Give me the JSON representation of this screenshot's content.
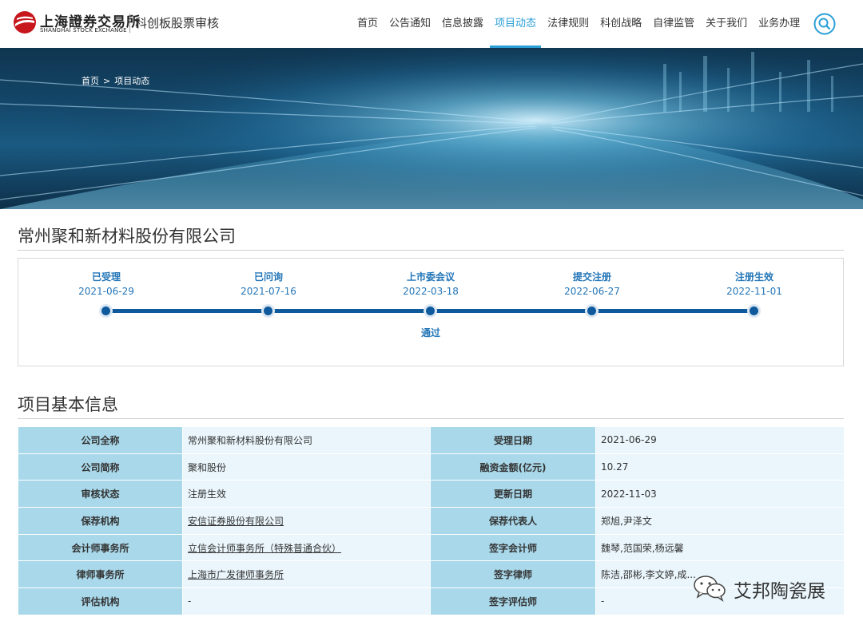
{
  "header": {
    "logo_cn": "上海證券交易所",
    "logo_en": "SHANGHAI STOCK EXCHANGE",
    "site_title": "科创板股票审核",
    "nav": [
      "首页",
      "公告通知",
      "信息披露",
      "项目动态",
      "法律规则",
      "科创战略",
      "自律监管",
      "关于我们",
      "业务办理"
    ],
    "active_nav": "项目动态",
    "search_icon": "search-icon"
  },
  "banner": {
    "breadcrumb": {
      "home": "首页",
      "separator": ">",
      "current": "项目动态"
    }
  },
  "company": {
    "name": "常州聚和新材料股份有限公司"
  },
  "timeline": {
    "steps": [
      {
        "label": "已受理",
        "date": "2021-06-29"
      },
      {
        "label": "已问询",
        "date": "2021-07-16"
      },
      {
        "label": "上市委会议",
        "date": "2022-03-18"
      },
      {
        "label": "提交注册",
        "date": "2022-06-27"
      },
      {
        "label": "注册生效",
        "date": "2022-11-01"
      }
    ],
    "note": "通过"
  },
  "basic_info": {
    "title": "项目基本信息",
    "rows": [
      [
        "公司全称",
        "常州聚和新材料股份有限公司",
        "受理日期",
        "2021-06-29"
      ],
      [
        "公司简称",
        "聚和股份",
        "融资金额(亿元)",
        "10.27"
      ],
      [
        "审核状态",
        "注册生效",
        "更新日期",
        "2022-11-03"
      ],
      [
        "保荐机构",
        "安信证券股份有限公司",
        "保荐代表人",
        "郑旭,尹泽文"
      ],
      [
        "会计师事务所",
        "立信会计师事务所（特殊普通合伙）",
        "签字会计师",
        "魏琴,范国荣,杨远馨"
      ],
      [
        "律师事务所",
        "上海市广发律师事务所",
        "签字律师",
        "陈洁,邵彬,李文婷,成..."
      ],
      [
        "评估机构",
        "-",
        "签字评估师",
        "-"
      ]
    ]
  },
  "watermark": {
    "text": "艾邦陶瓷展",
    "icon": "wechat-icon"
  },
  "colors": {
    "accent": "#2a9fd6",
    "timeline": "#0e5a9c",
    "key_cell": "#a8d8ea",
    "value_cell": "#eaf6fc",
    "logo_red": "#c8161d"
  }
}
